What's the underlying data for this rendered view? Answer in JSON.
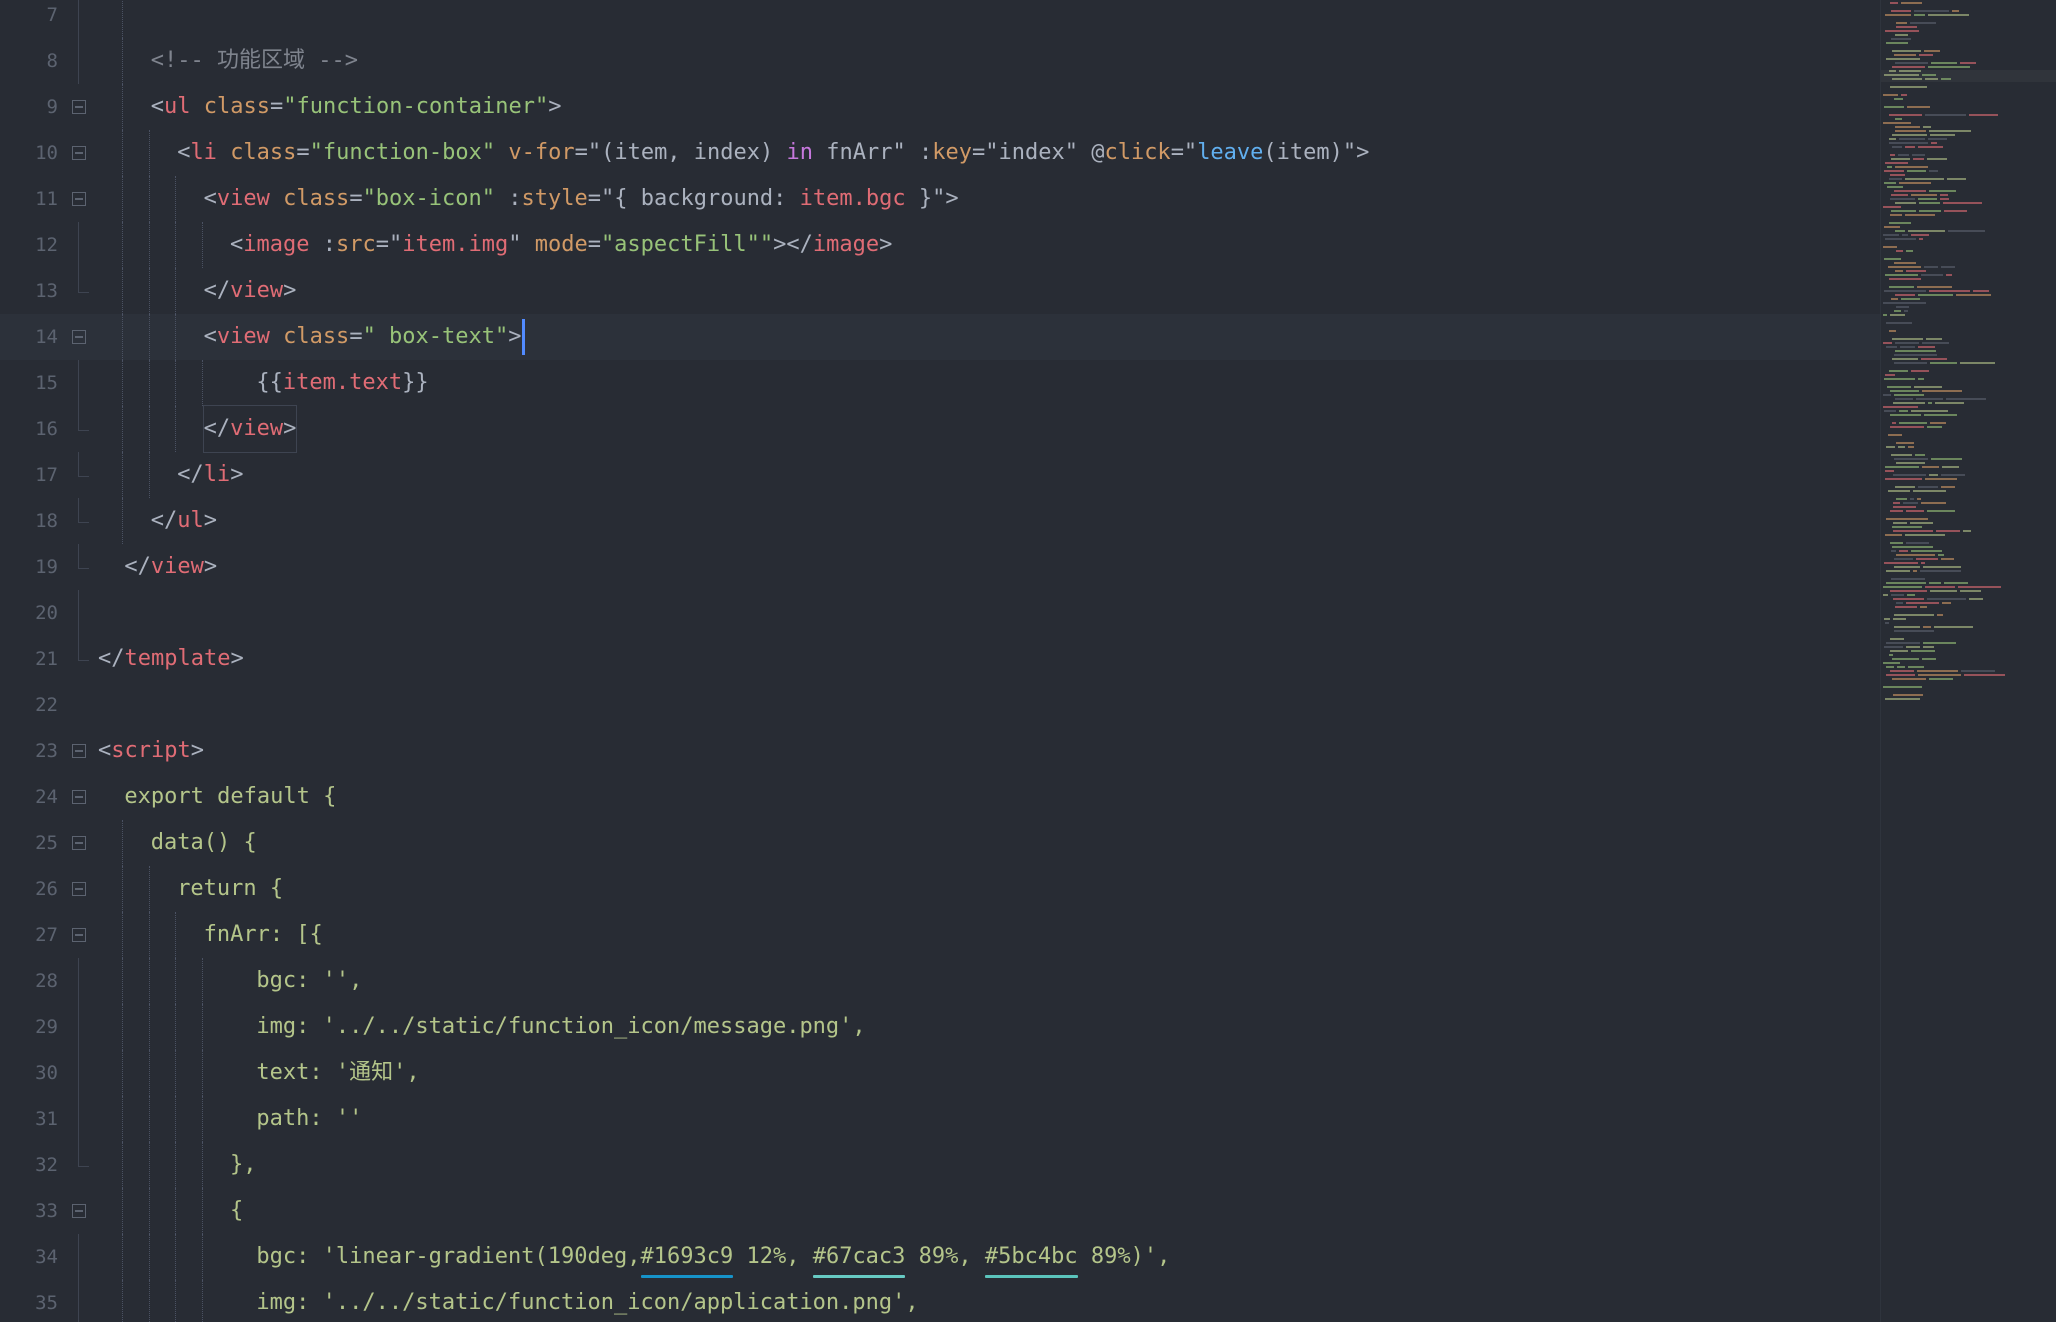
{
  "editor": {
    "theme_colors": {
      "background": "#282c34",
      "current_line": "#2c313a",
      "line_number": "#5c6370",
      "tag": "#e06c75",
      "attribute": "#d19a66",
      "string": "#98c379",
      "keyword": "#c678dd",
      "function": "#61afef",
      "comment": "#7f848e",
      "cursor": "#528bff"
    },
    "lines": [
      {
        "num": "7",
        "fold": "line",
        "indent": 0,
        "guides": [
          1
        ],
        "tokens": []
      },
      {
        "num": "8",
        "fold": "line",
        "indent": 2,
        "guides": [
          1
        ],
        "tokens": [
          {
            "c": "com",
            "t": "<!-- 功能区域 -->"
          }
        ]
      },
      {
        "num": "9",
        "fold": "box",
        "indent": 2,
        "guides": [
          1
        ],
        "tokens": [
          {
            "c": "pl",
            "t": "<"
          },
          {
            "c": "tag",
            "t": "ul"
          },
          {
            "c": "pl",
            "t": " "
          },
          {
            "c": "attr",
            "t": "class"
          },
          {
            "c": "pl",
            "t": "="
          },
          {
            "c": "str",
            "t": "\"function-container\""
          },
          {
            "c": "pl",
            "t": ">"
          }
        ]
      },
      {
        "num": "10",
        "fold": "box",
        "indent": 3,
        "guides": [
          1,
          2
        ],
        "tokens": [
          {
            "c": "pl",
            "t": "<"
          },
          {
            "c": "tag",
            "t": "li"
          },
          {
            "c": "pl",
            "t": " "
          },
          {
            "c": "attr",
            "t": "class"
          },
          {
            "c": "pl",
            "t": "="
          },
          {
            "c": "str",
            "t": "\"function-box\""
          },
          {
            "c": "pl",
            "t": " "
          },
          {
            "c": "attr",
            "t": "v-for"
          },
          {
            "c": "pl",
            "t": "=\"(item, index) "
          },
          {
            "c": "kw",
            "t": "in"
          },
          {
            "c": "pl",
            "t": " fnArr\" "
          },
          {
            "c": "pl",
            "t": ":"
          },
          {
            "c": "attr",
            "t": "key"
          },
          {
            "c": "pl",
            "t": "=\"index\" "
          },
          {
            "c": "pl",
            "t": "@"
          },
          {
            "c": "attr",
            "t": "click"
          },
          {
            "c": "pl",
            "t": "=\""
          },
          {
            "c": "fn",
            "t": "leave"
          },
          {
            "c": "pl",
            "t": "(item)\">"
          }
        ]
      },
      {
        "num": "11",
        "fold": "box",
        "indent": 4,
        "guides": [
          1,
          2,
          3
        ],
        "tokens": [
          {
            "c": "pl",
            "t": "<"
          },
          {
            "c": "tag",
            "t": "view"
          },
          {
            "c": "pl",
            "t": " "
          },
          {
            "c": "attr",
            "t": "class"
          },
          {
            "c": "pl",
            "t": "="
          },
          {
            "c": "str",
            "t": "\"box-icon\""
          },
          {
            "c": "pl",
            "t": " :"
          },
          {
            "c": "attr",
            "t": "style"
          },
          {
            "c": "pl",
            "t": "=\"{ background: "
          },
          {
            "c": "var",
            "t": "item.bgc"
          },
          {
            "c": "pl",
            "t": " }\">"
          }
        ]
      },
      {
        "num": "12",
        "fold": "line",
        "indent": 5,
        "guides": [
          1,
          2,
          3,
          4
        ],
        "tokens": [
          {
            "c": "pl",
            "t": "<"
          },
          {
            "c": "tag",
            "t": "image"
          },
          {
            "c": "pl",
            "t": " :"
          },
          {
            "c": "attr",
            "t": "src"
          },
          {
            "c": "pl",
            "t": "=\""
          },
          {
            "c": "var",
            "t": "item.img"
          },
          {
            "c": "pl",
            "t": "\" "
          },
          {
            "c": "attr",
            "t": "mode"
          },
          {
            "c": "pl",
            "t": "="
          },
          {
            "c": "str",
            "t": "\"aspectFill\"\""
          },
          {
            "c": "pl",
            "t": "></"
          },
          {
            "c": "tag",
            "t": "image"
          },
          {
            "c": "pl",
            "t": ">"
          }
        ]
      },
      {
        "num": "13",
        "fold": "end",
        "indent": 4,
        "guides": [
          1,
          2,
          3
        ],
        "tokens": [
          {
            "c": "pl",
            "t": "</"
          },
          {
            "c": "tag",
            "t": "view"
          },
          {
            "c": "pl",
            "t": ">"
          }
        ]
      },
      {
        "num": "14",
        "fold": "box",
        "indent": 4,
        "guides": [
          1,
          2,
          3
        ],
        "current": true,
        "tokens": [
          {
            "c": "pl",
            "t": "<"
          },
          {
            "c": "tag",
            "t": "view"
          },
          {
            "c": "pl",
            "t": " "
          },
          {
            "c": "attr",
            "t": "class"
          },
          {
            "c": "pl",
            "t": "="
          },
          {
            "c": "str",
            "t": "\" box-text\""
          },
          {
            "c": "pl",
            "t": ">"
          },
          {
            "c": "cursor",
            "t": ""
          }
        ]
      },
      {
        "num": "15",
        "fold": "line",
        "indent": 6,
        "guides": [
          1,
          2,
          3,
          4
        ],
        "tokens": [
          {
            "c": "pl",
            "t": "{{"
          },
          {
            "c": "var",
            "t": "item.text"
          },
          {
            "c": "pl",
            "t": "}}"
          }
        ]
      },
      {
        "num": "16",
        "fold": "end",
        "indent": 4,
        "guides": [
          1,
          2,
          3
        ],
        "boxed": true,
        "tokens": [
          {
            "c": "pl",
            "t": "</"
          },
          {
            "c": "tag",
            "t": "view"
          },
          {
            "c": "pl",
            "t": ">"
          }
        ]
      },
      {
        "num": "17",
        "fold": "end",
        "indent": 3,
        "guides": [
          1,
          2
        ],
        "tokens": [
          {
            "c": "pl",
            "t": "</"
          },
          {
            "c": "tag",
            "t": "li"
          },
          {
            "c": "pl",
            "t": ">"
          }
        ]
      },
      {
        "num": "18",
        "fold": "end",
        "indent": 2,
        "guides": [
          1
        ],
        "tokens": [
          {
            "c": "pl",
            "t": "</"
          },
          {
            "c": "tag",
            "t": "ul"
          },
          {
            "c": "pl",
            "t": ">"
          }
        ]
      },
      {
        "num": "19",
        "fold": "end",
        "indent": 1,
        "guides": [],
        "tokens": [
          {
            "c": "pl",
            "t": "</"
          },
          {
            "c": "tag",
            "t": "view"
          },
          {
            "c": "pl",
            "t": ">"
          }
        ]
      },
      {
        "num": "20",
        "fold": "line",
        "indent": 0,
        "guides": [],
        "tokens": []
      },
      {
        "num": "21",
        "fold": "end",
        "indent": 0,
        "guides": [],
        "tokens": [
          {
            "c": "pl",
            "t": "</"
          },
          {
            "c": "tag",
            "t": "template"
          },
          {
            "c": "pl",
            "t": ">"
          }
        ]
      },
      {
        "num": "22",
        "fold": "none",
        "indent": 0,
        "guides": [],
        "tokens": []
      },
      {
        "num": "23",
        "fold": "box",
        "indent": 0,
        "guides": [],
        "tokens": [
          {
            "c": "pl",
            "t": "<"
          },
          {
            "c": "tag",
            "t": "script"
          },
          {
            "c": "pl",
            "t": ">"
          }
        ]
      },
      {
        "num": "24",
        "fold": "box",
        "indent": 1,
        "guides": [],
        "tokens": [
          {
            "c": "js",
            "t": "export default {"
          }
        ]
      },
      {
        "num": "25",
        "fold": "box",
        "indent": 2,
        "guides": [
          1
        ],
        "tokens": [
          {
            "c": "js",
            "t": "data() {"
          }
        ]
      },
      {
        "num": "26",
        "fold": "box",
        "indent": 3,
        "guides": [
          1,
          2
        ],
        "tokens": [
          {
            "c": "js",
            "t": "return {"
          }
        ]
      },
      {
        "num": "27",
        "fold": "box",
        "indent": 4,
        "guides": [
          1,
          2,
          3
        ],
        "tokens": [
          {
            "c": "js",
            "t": "fnArr: [{"
          }
        ]
      },
      {
        "num": "28",
        "fold": "line",
        "indent": 6,
        "guides": [
          1,
          2,
          3,
          4
        ],
        "tokens": [
          {
            "c": "js",
            "t": "bgc: '',"
          }
        ]
      },
      {
        "num": "29",
        "fold": "line",
        "indent": 6,
        "guides": [
          1,
          2,
          3,
          4
        ],
        "tokens": [
          {
            "c": "js",
            "t": "img: '../../static/function_icon/message.png',"
          }
        ]
      },
      {
        "num": "30",
        "fold": "line",
        "indent": 6,
        "guides": [
          1,
          2,
          3,
          4
        ],
        "tokens": [
          {
            "c": "js",
            "t": "text: '通知',"
          }
        ]
      },
      {
        "num": "31",
        "fold": "line",
        "indent": 6,
        "guides": [
          1,
          2,
          3,
          4
        ],
        "tokens": [
          {
            "c": "js",
            "t": "path: ''"
          }
        ]
      },
      {
        "num": "32",
        "fold": "end",
        "indent": 5,
        "guides": [
          1,
          2,
          3,
          4
        ],
        "tokens": [
          {
            "c": "js",
            "t": "},"
          }
        ]
      },
      {
        "num": "33",
        "fold": "box",
        "indent": 5,
        "guides": [
          1,
          2,
          3,
          4
        ],
        "tokens": [
          {
            "c": "js",
            "t": "{"
          }
        ]
      },
      {
        "num": "34",
        "fold": "line",
        "indent": 6,
        "guides": [
          1,
          2,
          3,
          4
        ],
        "tokens": [
          {
            "c": "js",
            "t": "bgc: 'linear-gradient(190deg,"
          },
          {
            "c": "swatch",
            "t": "#1693c9",
            "color": "#1693c9"
          },
          {
            "c": "js",
            "t": " 12%, "
          },
          {
            "c": "swatch",
            "t": "#67cac3",
            "color": "#67cac3"
          },
          {
            "c": "js",
            "t": " 89%, "
          },
          {
            "c": "swatch",
            "t": "#5bc4bc",
            "color": "#5bc4bc"
          },
          {
            "c": "js",
            "t": " 89%)',"
          }
        ]
      },
      {
        "num": "35",
        "fold": "line",
        "indent": 6,
        "guides": [
          1,
          2,
          3,
          4
        ],
        "tokens": [
          {
            "c": "js",
            "t": "img: '../../static/function_icon/application.png',"
          }
        ]
      }
    ]
  }
}
